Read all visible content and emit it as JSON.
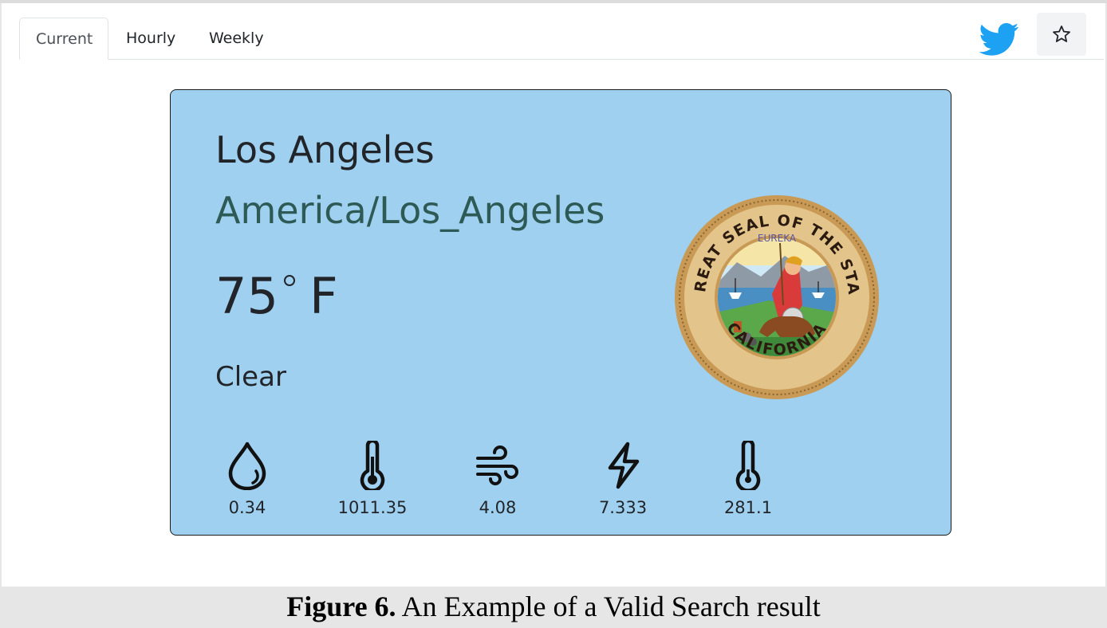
{
  "tabs": [
    {
      "label": "Current",
      "active": true
    },
    {
      "label": "Hourly",
      "active": false
    },
    {
      "label": "Weekly",
      "active": false
    }
  ],
  "toolbar": {
    "twitter_icon": "twitter-bird-icon",
    "star_icon": "star-outline-icon",
    "twitter_color": "#1da1f2"
  },
  "card": {
    "city": "Los Angeles",
    "timezone": "America/Los_Angeles",
    "temperature": "75",
    "temperature_unit": "F",
    "summary": "Clear",
    "background_color": "#9fd0ef",
    "seal": {
      "top_text": "THE GREAT SEAL OF THE STATE OF",
      "bottom_text": "CALIFORNIA",
      "motto": "EUREKA"
    },
    "metrics": [
      {
        "icon": "humidity-drop-icon",
        "value": "0.34"
      },
      {
        "icon": "pressure-thermometer-icon",
        "value": "1011.35"
      },
      {
        "icon": "wind-icon",
        "value": "4.08"
      },
      {
        "icon": "visibility-bolt-icon",
        "value": "7.333"
      },
      {
        "icon": "ozone-thermometer-icon",
        "value": "281.1"
      }
    ]
  },
  "caption": {
    "label": "Figure 6.",
    "text": " An Example of a Valid Search result"
  }
}
